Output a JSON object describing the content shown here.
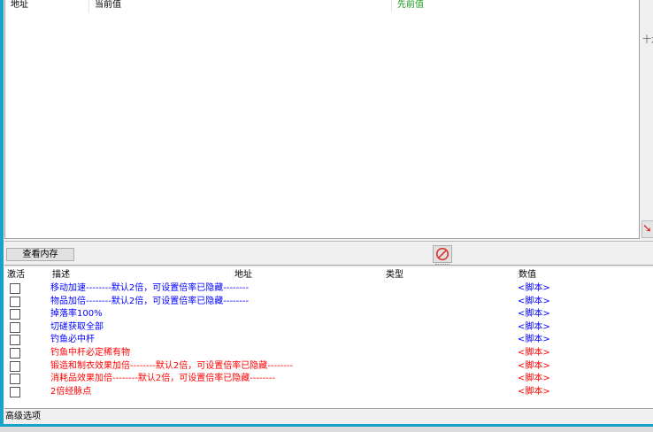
{
  "results": {
    "columns": [
      "地址",
      "当前值",
      "先前值"
    ]
  },
  "side": {
    "hex_label": "十六进制",
    "arrow_icon": "red-arrow-icon"
  },
  "toolbar": {
    "view_memory": "查看内存",
    "stop_icon": "no-entry-icon"
  },
  "table": {
    "columns": [
      "激活",
      "描述",
      "地址",
      "类型",
      "数值"
    ],
    "rows": [
      {
        "desc": "移动加速--------默认2倍，可设置倍率已隐藏--------",
        "value": "<脚本>",
        "color": "#0000ff"
      },
      {
        "desc": "物品加倍--------默认2倍，可设置倍率已隐藏--------",
        "value": "<脚本>",
        "color": "#0000ff"
      },
      {
        "desc": "掉落率100%",
        "value": "<脚本>",
        "color": "#0000ff"
      },
      {
        "desc": "切磋获取全部",
        "value": "<脚本>",
        "color": "#0000ff"
      },
      {
        "desc": "钓鱼必中杆",
        "value": "<脚本>",
        "color": "#0000ff"
      },
      {
        "desc": "钓鱼中杆必定稀有物",
        "value": "<脚本>",
        "color": "#ff0000"
      },
      {
        "desc": "锻造和制衣效果加倍--------默认2倍，可设置倍率已隐藏--------",
        "value": "<脚本>",
        "color": "#ff0000"
      },
      {
        "desc": "消耗品效果加倍--------默认2倍，可设置倍率已隐藏--------",
        "value": "<脚本>",
        "color": "#ff0000"
      },
      {
        "desc": "2倍经脉点",
        "value": "<脚本>",
        "color": "#ff0000"
      }
    ]
  },
  "status": {
    "advanced": "高级选项"
  }
}
